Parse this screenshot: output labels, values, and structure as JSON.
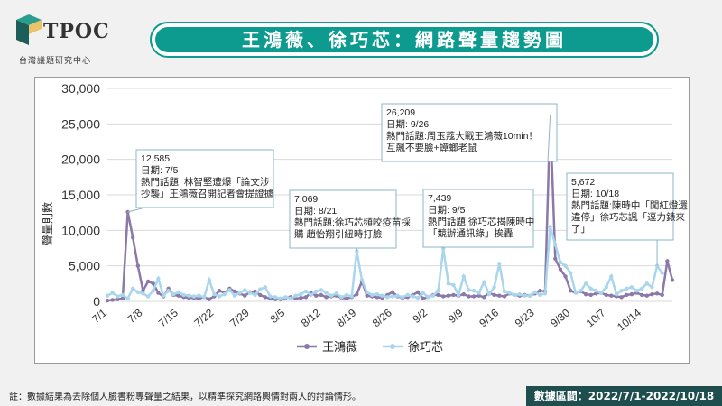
{
  "header": {
    "logo_text": "TPOC",
    "logo_subtitle": "台灣議題研究中心",
    "title": "王鴻薇、徐巧芯：網路聲量趨勢圖"
  },
  "colors": {
    "series_1": "#8b79a8",
    "series_2": "#a9d6ec",
    "title_bar": "#0d9a8f",
    "footer": "#1f4e4e"
  },
  "footer": {
    "note": "註：數據結果為去除個人臉書粉專聲量之結果，以精準探究網路輿情對兩人的討論情形。",
    "range": "數據區間：2022/7/1-2022/10/18"
  },
  "chart_data": {
    "type": "line",
    "title": "",
    "ylabel": "聲量則數",
    "xlabel": "",
    "ylim": [
      0,
      30000
    ],
    "yticks": [
      "0",
      "5,000",
      "10,000",
      "15,000",
      "20,000",
      "25,000",
      "30,000"
    ],
    "x_tick_labels": [
      "7/1",
      "7/8",
      "7/15",
      "7/22",
      "7/29",
      "8/5",
      "8/12",
      "8/19",
      "8/26",
      "9/2",
      "9/9",
      "9/16",
      "9/23",
      "9/30",
      "10/7",
      "10/14"
    ],
    "grid": true,
    "legend_position": "bottom",
    "series": [
      {
        "name": "王鴻薇",
        "values": [
          100,
          200,
          300,
          400,
          12585,
          9000,
          5000,
          1500,
          2800,
          2500,
          1200,
          700,
          1800,
          900,
          800,
          600,
          500,
          500,
          400,
          600,
          300,
          700,
          1500,
          1200,
          1800,
          1400,
          1100,
          800,
          1300,
          1400,
          900,
          600,
          400,
          300,
          300,
          500,
          600,
          400,
          500,
          600,
          1200,
          800,
          900,
          600,
          700,
          800,
          500,
          400,
          600,
          1000,
          2800,
          800,
          700,
          600,
          500,
          900,
          1300,
          700,
          500,
          600,
          900,
          1300,
          400,
          600,
          900,
          900,
          700,
          800,
          900,
          800,
          1000,
          700,
          700,
          800,
          600,
          1200,
          900,
          800,
          700,
          1100,
          900,
          800,
          900,
          800,
          1100,
          1500,
          1400,
          26209,
          6000,
          4500,
          3500,
          1500,
          1200,
          1400,
          1000,
          900,
          1100,
          1200,
          900,
          800,
          700,
          600,
          900,
          1000,
          1200,
          900,
          800,
          1000,
          1100,
          900,
          5672,
          3000
        ]
      },
      {
        "name": "徐巧芯",
        "values": [
          800,
          1200,
          700,
          900,
          400,
          1800,
          1300,
          1100,
          700,
          1500,
          3200,
          800,
          1500,
          1000,
          1300,
          900,
          800,
          700,
          800,
          600,
          3000,
          1000,
          700,
          1000,
          1600,
          800,
          1200,
          1600,
          1200,
          900,
          1700,
          2000,
          700,
          600,
          400,
          600,
          400,
          800,
          1000,
          1400,
          900,
          1400,
          1600,
          1200,
          800,
          1100,
          600,
          900,
          700,
          7069,
          3000,
          1300,
          900,
          1000,
          800,
          600,
          700,
          800,
          600,
          900,
          700,
          500,
          1200,
          600,
          800,
          1500,
          7439,
          2500,
          2300,
          900,
          3500,
          1600,
          1500,
          1200,
          2700,
          1000,
          2000,
          5300,
          1400,
          1200,
          900,
          1000,
          800,
          800,
          1300,
          900,
          1100,
          10500,
          8000,
          5500,
          5000,
          4000,
          1200,
          1500,
          2500,
          1800,
          1500,
          1200,
          2000,
          3500,
          1000,
          1500,
          1800,
          2000,
          1500,
          1800,
          2500,
          2000,
          5000,
          4000
        ]
      }
    ],
    "annotations": [
      {
        "value": "12,585",
        "date": "日期: 7/5",
        "topic": "熱門話題: 林智堅遭爆「論文涉抄襲」王鴻薇召開記者會提證據"
      },
      {
        "value": "7,069",
        "date": "日期: 8/21",
        "topic": "熱門話題:徐巧芯頻咬疫苗採購 趙怡翔引紐時打臉"
      },
      {
        "value": "26,209",
        "date": "日期: 9/26",
        "topic": "熱門話題:周玉蔻大戰王鴻薇10min！互飆不要臉+蟑螂老鼠"
      },
      {
        "value": "7,439",
        "date": "日期: 9/5",
        "topic": "熱門話題:徐巧芯揭陳時中「競辦通訊錄」挨轟"
      },
      {
        "value": "5,672",
        "date": "日期: 10/18",
        "topic": "熱門話題:陳時中「闖紅燈還違停」徐巧芯諷「逗力錶來了」"
      }
    ]
  }
}
